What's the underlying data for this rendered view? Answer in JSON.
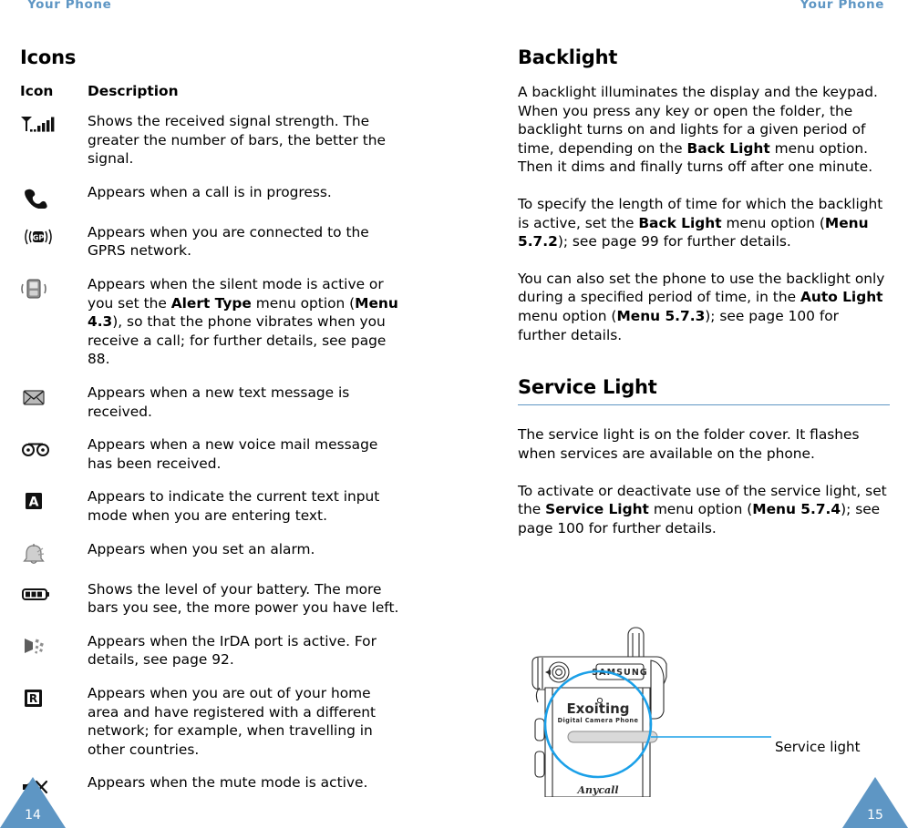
{
  "header": {
    "left_title": "Your Phone",
    "right_title": "Your Phone",
    "color": "#5e96c4"
  },
  "left_page": {
    "number": "14",
    "section_title": "Icons",
    "table": {
      "col_icon_header": "Icon",
      "col_desc_header": "Description",
      "rows": [
        {
          "icon": "signal-strength-icon",
          "description_parts": [
            {
              "text": "Shows the received signal strength. The greater the number of bars, the better the signal.",
              "bold": false
            }
          ]
        },
        {
          "icon": "call-in-progress-icon",
          "description_parts": [
            {
              "text": "Appears when a call is in progress.",
              "bold": false
            }
          ]
        },
        {
          "icon": "gprs-network-icon",
          "description_parts": [
            {
              "text": "Appears when you are connected to the GPRS network.",
              "bold": false
            }
          ]
        },
        {
          "icon": "vibrate-silent-mode-icon",
          "description_parts": [
            {
              "text": "Appears when the silent mode is active or you set the ",
              "bold": false
            },
            {
              "text": "Alert Type",
              "bold": true
            },
            {
              "text": " menu option (",
              "bold": false
            },
            {
              "text": "Menu 4.3",
              "bold": true
            },
            {
              "text": "), so that the phone vibrates when you receive a call; for further details, see page 88.",
              "bold": false
            }
          ]
        },
        {
          "icon": "new-text-message-icon",
          "description_parts": [
            {
              "text": "Appears when a new text message is received.",
              "bold": false
            }
          ]
        },
        {
          "icon": "voice-mail-icon",
          "description_parts": [
            {
              "text": "Appears when a new voice mail message has been received.",
              "bold": false
            }
          ]
        },
        {
          "icon": "text-input-mode-icon",
          "description_parts": [
            {
              "text": "Appears to indicate the current text input mode when you are entering text.",
              "bold": false
            }
          ]
        },
        {
          "icon": "alarm-icon",
          "description_parts": [
            {
              "text": "Appears when you set an alarm.",
              "bold": false
            }
          ]
        },
        {
          "icon": "battery-level-icon",
          "description_parts": [
            {
              "text": "Shows the level of your battery. The more bars you see, the more power you have left.",
              "bold": false
            }
          ]
        },
        {
          "icon": "irda-port-icon",
          "description_parts": [
            {
              "text": "Appears when the IrDA port is active. For details, see page 92.",
              "bold": false
            }
          ]
        },
        {
          "icon": "roaming-icon",
          "description_parts": [
            {
              "text": "Appears when you are out of your home area and have registered with a different network; for example, when travelling in other countries.",
              "bold": false
            }
          ]
        },
        {
          "icon": "mute-mode-icon",
          "description_parts": [
            {
              "text": "Appears when the mute mode is active.",
              "bold": false
            }
          ]
        }
      ]
    }
  },
  "right_page": {
    "number": "15",
    "backlight": {
      "title": "Backlight",
      "paragraphs": [
        [
          {
            "text": "A backlight illuminates the display and the keypad. When you press any key or open the folder, the backlight turns on and lights for a given period of time, depending on the ",
            "bold": false
          },
          {
            "text": "Back Light",
            "bold": true
          },
          {
            "text": " menu option. Then it dims and finally turns off after one minute.",
            "bold": false
          }
        ],
        [
          {
            "text": "To specify the length of time for which the backlight is active, set the ",
            "bold": false
          },
          {
            "text": "Back Light",
            "bold": true
          },
          {
            "text": " menu option (",
            "bold": false
          },
          {
            "text": "Menu 5.7.2",
            "bold": true
          },
          {
            "text": "); see page 99 for further details.",
            "bold": false
          }
        ],
        [
          {
            "text": "You can also set the phone to use the backlight only during a specified period of time, in the ",
            "bold": false
          },
          {
            "text": "Auto Light",
            "bold": true
          },
          {
            "text": " menu option (",
            "bold": false
          },
          {
            "text": "Menu 5.7.3",
            "bold": true
          },
          {
            "text": "); see page 100 for further details.",
            "bold": false
          }
        ]
      ]
    },
    "service_light": {
      "title": "Service Light",
      "paragraphs": [
        [
          {
            "text": "The service light is on the folder cover. It flashes when services are available on the phone.",
            "bold": false
          }
        ],
        [
          {
            "text": "To activate or deactivate use of the service light, set the ",
            "bold": false
          },
          {
            "text": "Service Light",
            "bold": true
          },
          {
            "text": " menu option (",
            "bold": false
          },
          {
            "text": "Menu 5.7.4",
            "bold": true
          },
          {
            "text": "); see page 100 for further details.",
            "bold": false
          }
        ]
      ]
    },
    "figure": {
      "callout_label": "Service light",
      "phone_brand": "SAMSUNG",
      "phone_model_text": "Exoiting",
      "phone_model_subtext": "Digital Camera Phone",
      "phone_footer_text": "Anycall",
      "highlight_color": "#1ba0e8"
    }
  }
}
